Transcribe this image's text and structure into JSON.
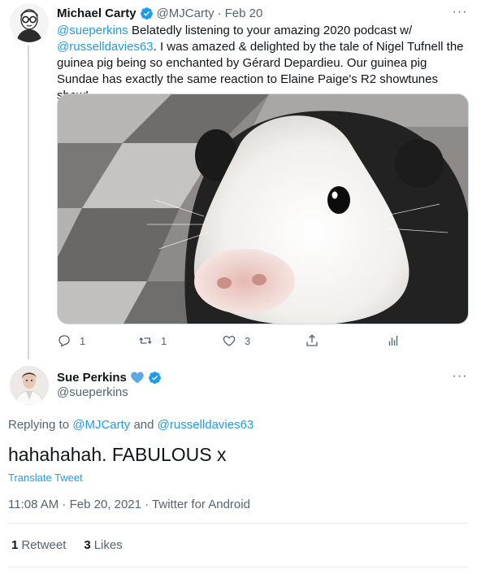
{
  "parent_tweet": {
    "author_name": "Michael Carty",
    "handle": "@MJCarty",
    "separator": "·",
    "date": "Feb 20",
    "text_parts": {
      "mention1": "@sueperkins",
      "text1": " Belatedly listening to your amazing 2020 podcast w/ ",
      "mention2": "@russelldavies63",
      "text2": ". I was amazed & delighted by the tale of Nigel Tufnell the guinea pig being so enchanted by Gérard Depardieu. Our guinea pig Sundae has exactly the same reaction to Elaine Paige's R2 showtunes show!"
    },
    "more": "···",
    "actions": {
      "reply_count": "1",
      "retweet_count": "1",
      "like_count": "3"
    }
  },
  "main_tweet": {
    "author_name": "Sue Perkins",
    "handle": "@sueperkins",
    "more": "···",
    "replying_label": "Replying to ",
    "replying_to1": "@MJCarty",
    "replying_and": " and ",
    "replying_to2": "@russelldavies63",
    "text": "hahahahah. FABULOUS x",
    "translate": "Translate Tweet",
    "meta": "11:08 AM · Feb 20, 2021 · Twitter for Android",
    "stats": {
      "retweets_num": "1",
      "retweets_label": "Retweet",
      "likes_num": "3",
      "likes_label": "Likes"
    }
  },
  "colors": {
    "accent": "#1d9bf0",
    "text": "#0f1419",
    "secondary": "#536471",
    "border": "#cfd9de"
  }
}
